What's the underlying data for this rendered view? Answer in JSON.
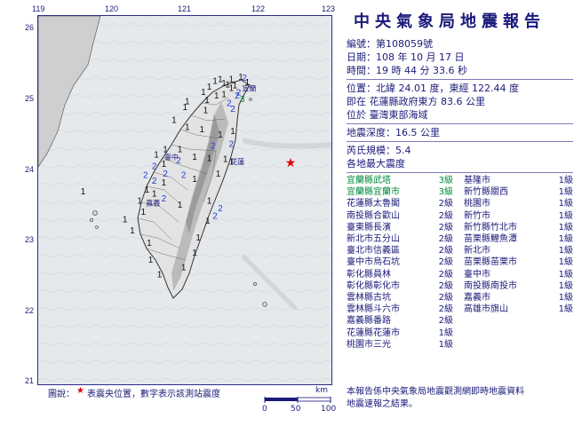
{
  "report": {
    "title": "中央氣象局地震報告",
    "number_label": "編號：",
    "number": "第108059號",
    "date_label": "日期：",
    "date": "108 年 10 月 17 日",
    "time_label": "時間：",
    "time": "19 時 44 分 33.6 秒",
    "position_label": "位置：",
    "position": "北緯 24.01 度，東經 122.44 度",
    "position_line2": "即在 花蓮縣政府東方 83.6 公里",
    "position_line3": "位於 臺灣東部海域",
    "depth_label": "地震深度：",
    "depth": "16.5 公里",
    "magnitude_label": "芮氏規模：",
    "magnitude": "5.4",
    "intensity_header": "各地最大震度"
  },
  "intensities_left": [
    {
      "place": "宜蘭縣武塔",
      "level": "3級",
      "highlight": true
    },
    {
      "place": "宜蘭縣宜蘭市",
      "level": "3級",
      "highlight": true
    },
    {
      "place": "花蓮縣太魯閣",
      "level": "2級",
      "highlight": false
    },
    {
      "place": "南投縣合歡山",
      "level": "2級",
      "highlight": false
    },
    {
      "place": "臺東縣長濱",
      "level": "2級",
      "highlight": false
    },
    {
      "place": "新北市五分山",
      "level": "2級",
      "highlight": false
    },
    {
      "place": "臺北市信義區",
      "level": "2級",
      "highlight": false
    },
    {
      "place": "臺中市烏石坑",
      "level": "2級",
      "highlight": false
    },
    {
      "place": "彰化縣員林",
      "level": "2級",
      "highlight": false
    },
    {
      "place": "彰化縣彰化市",
      "level": "2級",
      "highlight": false
    },
    {
      "place": "雲林縣古坑",
      "level": "2級",
      "highlight": false
    },
    {
      "place": "雲林縣斗六市",
      "level": "2級",
      "highlight": false
    },
    {
      "place": "嘉義縣番路",
      "level": "2級",
      "highlight": false
    },
    {
      "place": "花蓮縣花蓮市",
      "level": "1級",
      "highlight": false
    },
    {
      "place": "桃園市三光",
      "level": "1級",
      "highlight": false
    }
  ],
  "intensities_right": [
    {
      "place": "基隆市",
      "level": "1級"
    },
    {
      "place": "新竹縣關西",
      "level": "1級"
    },
    {
      "place": "桃園市",
      "level": "1級"
    },
    {
      "place": "新竹市",
      "level": "1級"
    },
    {
      "place": "新竹縣竹北市",
      "level": "1級"
    },
    {
      "place": "苗栗縣鯉魚潭",
      "level": "1級"
    },
    {
      "place": "新北市",
      "level": "1級"
    },
    {
      "place": "苗栗縣苗栗市",
      "level": "1級"
    },
    {
      "place": "臺中市",
      "level": "1級"
    },
    {
      "place": "南投縣南投市",
      "level": "1級"
    },
    {
      "place": "嘉義市",
      "level": "1級"
    },
    {
      "place": "高雄市旗山",
      "level": "1級"
    }
  ],
  "footer": {
    "line1": "本報告係中央氣象局地震觀測網即時地震資料",
    "line2": "地震速報之結果。"
  },
  "map": {
    "lon_ticks": [
      "119",
      "120",
      "121",
      "122",
      "123"
    ],
    "lat_ticks": [
      "26",
      "25",
      "24",
      "23",
      "22",
      "21"
    ],
    "legend_prefix": "圖說：",
    "legend_star": "★",
    "legend_text": "表震央位置，數字表示該測站震度",
    "scale_unit": "km",
    "scale_labels": [
      "0",
      "50",
      "100"
    ],
    "epicenter": {
      "lat": 24.01,
      "lon": 122.44
    },
    "city_labels": {
      "yilan": "宜蘭",
      "taichung": "臺中",
      "hualien": "花蓮",
      "chiayi": "嘉義"
    },
    "stations": [
      {
        "lon": 121.73,
        "lat": 25.13,
        "v": "1"
      },
      {
        "lon": 121.6,
        "lat": 25.1,
        "v": "1"
      },
      {
        "lon": 121.5,
        "lat": 25.05,
        "v": "1"
      },
      {
        "lon": 121.45,
        "lat": 25.1,
        "v": "1"
      },
      {
        "lon": 121.38,
        "lat": 25.08,
        "v": "1"
      },
      {
        "lon": 121.78,
        "lat": 25.12,
        "v": "2"
      },
      {
        "lon": 121.82,
        "lat": 25.06,
        "v": "1"
      },
      {
        "lon": 121.3,
        "lat": 25.0,
        "v": "1"
      },
      {
        "lon": 121.22,
        "lat": 24.93,
        "v": "1"
      },
      {
        "lon": 121.6,
        "lat": 24.98,
        "v": "1"
      },
      {
        "lon": 121.55,
        "lat": 25.03,
        "v": "1"
      },
      {
        "lon": 121.65,
        "lat": 25.02,
        "v": "1"
      },
      {
        "lon": 121.7,
        "lat": 24.92,
        "v": "2"
      },
      {
        "lon": 121.75,
        "lat": 24.83,
        "v": "3"
      },
      {
        "lon": 121.68,
        "lat": 24.88,
        "v": "2"
      },
      {
        "lon": 121.5,
        "lat": 24.9,
        "v": "1"
      },
      {
        "lon": 121.4,
        "lat": 24.88,
        "v": "1"
      },
      {
        "lon": 121.27,
        "lat": 24.82,
        "v": "1"
      },
      {
        "lon": 121.0,
        "lat": 24.8,
        "v": "1"
      },
      {
        "lon": 120.97,
        "lat": 24.72,
        "v": "1"
      },
      {
        "lon": 121.57,
        "lat": 24.78,
        "v": "2"
      },
      {
        "lon": 121.62,
        "lat": 24.7,
        "v": "2"
      },
      {
        "lon": 121.25,
        "lat": 24.68,
        "v": "1"
      },
      {
        "lon": 120.82,
        "lat": 24.55,
        "v": "1"
      },
      {
        "lon": 121.0,
        "lat": 24.45,
        "v": "1"
      },
      {
        "lon": 121.2,
        "lat": 24.42,
        "v": "1"
      },
      {
        "lon": 121.45,
        "lat": 24.35,
        "v": "1"
      },
      {
        "lon": 121.62,
        "lat": 24.4,
        "v": "1"
      },
      {
        "lon": 121.6,
        "lat": 24.22,
        "v": "2"
      },
      {
        "lon": 121.35,
        "lat": 24.2,
        "v": "2"
      },
      {
        "lon": 120.7,
        "lat": 24.15,
        "v": "1"
      },
      {
        "lon": 120.9,
        "lat": 24.15,
        "v": "1"
      },
      {
        "lon": 121.1,
        "lat": 24.05,
        "v": "1"
      },
      {
        "lon": 120.88,
        "lat": 24.0,
        "v": "2"
      },
      {
        "lon": 120.58,
        "lat": 24.08,
        "v": "1"
      },
      {
        "lon": 121.3,
        "lat": 24.03,
        "v": "1"
      },
      {
        "lon": 121.52,
        "lat": 24.02,
        "v": "1"
      },
      {
        "lon": 121.6,
        "lat": 23.98,
        "v": "1"
      },
      {
        "lon": 120.55,
        "lat": 23.92,
        "v": "2"
      },
      {
        "lon": 120.68,
        "lat": 23.95,
        "v": "1"
      },
      {
        "lon": 120.7,
        "lat": 23.82,
        "v": "2"
      },
      {
        "lon": 120.43,
        "lat": 23.8,
        "v": "2"
      },
      {
        "lon": 120.55,
        "lat": 23.72,
        "v": "2"
      },
      {
        "lon": 120.68,
        "lat": 23.7,
        "v": "1"
      },
      {
        "lon": 120.95,
        "lat": 23.8,
        "v": "2"
      },
      {
        "lon": 121.1,
        "lat": 23.75,
        "v": "1"
      },
      {
        "lon": 121.42,
        "lat": 23.82,
        "v": "1"
      },
      {
        "lon": 120.45,
        "lat": 23.6,
        "v": "1"
      },
      {
        "lon": 120.55,
        "lat": 23.55,
        "v": "1"
      },
      {
        "lon": 120.68,
        "lat": 23.48,
        "v": "2"
      },
      {
        "lon": 120.35,
        "lat": 23.45,
        "v": "1"
      },
      {
        "lon": 120.9,
        "lat": 23.4,
        "v": "1"
      },
      {
        "lon": 121.3,
        "lat": 23.45,
        "v": "1"
      },
      {
        "lon": 121.45,
        "lat": 23.35,
        "v": "2"
      },
      {
        "lon": 121.38,
        "lat": 23.25,
        "v": "2"
      },
      {
        "lon": 121.28,
        "lat": 23.18,
        "v": "1"
      },
      {
        "lon": 120.4,
        "lat": 23.3,
        "v": "1"
      },
      {
        "lon": 120.15,
        "lat": 23.2,
        "v": "1"
      },
      {
        "lon": 120.25,
        "lat": 23.05,
        "v": "1"
      },
      {
        "lon": 120.48,
        "lat": 22.88,
        "v": "1"
      },
      {
        "lon": 121.15,
        "lat": 22.95,
        "v": "1"
      },
      {
        "lon": 121.1,
        "lat": 22.75,
        "v": "1"
      },
      {
        "lon": 120.5,
        "lat": 22.65,
        "v": "1"
      },
      {
        "lon": 120.95,
        "lat": 22.55,
        "v": "1"
      },
      {
        "lon": 120.62,
        "lat": 22.45,
        "v": "1"
      },
      {
        "lon": 119.58,
        "lat": 23.58,
        "v": "1"
      }
    ]
  }
}
